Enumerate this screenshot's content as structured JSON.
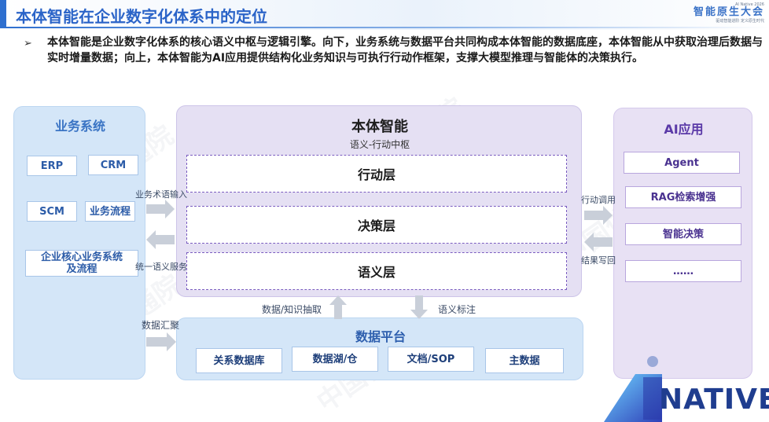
{
  "header": {
    "title": "本体智能在企业数字化体系中的定位",
    "logo_small": "AI Native 2026",
    "logo_big": "智能原生大会",
    "logo_tag": "驱动智能进阶 定义原生时代"
  },
  "intro": {
    "bullet": "➢",
    "text": "本体智能是企业数字化体系的核心语义中枢与逻辑引擎。向下，业务系统与数据平台共同构成本体智能的数据底座，本体智能从中获取治理后数据与实时增量数据；向上，本体智能为AI应用提供结构化业务知识与可执行行动作框架，支撑大模型推理与智能体的决策执行。"
  },
  "business": {
    "title": "业务系统",
    "items": [
      "ERP",
      "CRM",
      "SCM",
      "业务流程",
      "企业核心业务系统及流程"
    ]
  },
  "core": {
    "title": "本体智能",
    "subtitle": "语义-行动中枢",
    "layers": [
      "行动层",
      "决策层",
      "语义层"
    ]
  },
  "ai": {
    "title": "AI应用",
    "items": [
      "Agent",
      "RAG检索增强",
      "智能决策",
      "……"
    ]
  },
  "platform": {
    "title": "数据平台",
    "items": [
      "关系数据库",
      "数据湖/仓",
      "文档/SOP",
      "主数据"
    ]
  },
  "labels": {
    "biz_input": "业务术语输入",
    "unified": "统一语义服务",
    "data_collect": "数据汇聚",
    "extract": "数据/知识抽取",
    "annotate": "语义标注",
    "action_call": "行动调用",
    "writeback": "结果写回"
  },
  "watermark": "中国信通院",
  "brand": "NATIVE",
  "colors": {
    "accent": "#2e6fcf",
    "core_border": "#7a5cc0",
    "panel_blue": "#d4e6f8",
    "panel_purple": "#e5e0f3"
  }
}
